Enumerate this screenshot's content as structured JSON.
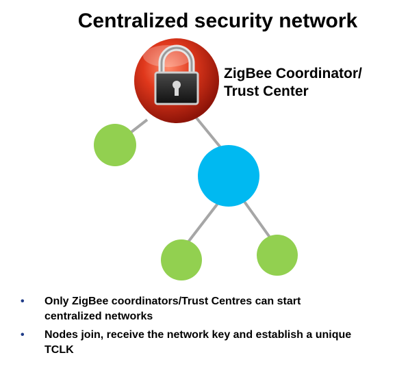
{
  "title": "Centralized security network",
  "coordinator": {
    "label_line1": "ZigBee Coordinator/",
    "label_line2": "Trust Center",
    "icon": "lock-icon"
  },
  "bullets": [
    {
      "marker": "•",
      "text_line1": "Only ZigBee coordinators/Trust  Centres can  start",
      "text_line2": "centralized  networks"
    },
    {
      "marker": "•",
      "text_line1": "Nodes join, receive the network key and establish a unique",
      "text_line2": "TCLK"
    }
  ],
  "colors": {
    "coordinator": "#d9301a",
    "router": "#00b9f1",
    "end_device": "#92d050",
    "link": "#a6a6a6",
    "bullet": "#1f3c88"
  }
}
